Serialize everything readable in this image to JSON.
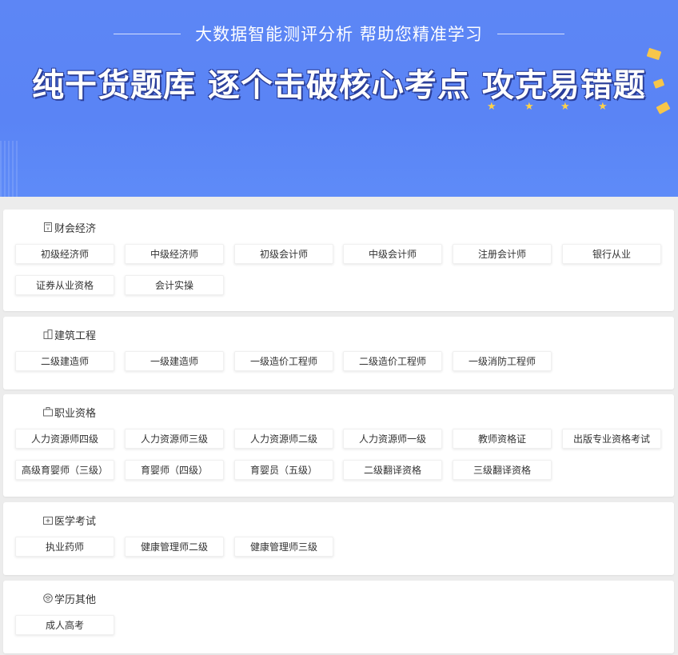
{
  "banner": {
    "subtitle": "大数据智能测评分析 帮助您精准学习",
    "headline": "纯干货题库 逐个击破核心考点 攻克易错题"
  },
  "categories": [
    {
      "name": "财会经济",
      "icon": "calculator-icon",
      "items": [
        "初级经济师",
        "中级经济师",
        "初级会计师",
        "中级会计师",
        "注册会计师",
        "银行从业",
        "证券从业资格",
        "会计实操"
      ]
    },
    {
      "name": "建筑工程",
      "icon": "building-icon",
      "items": [
        "二级建造师",
        "一级建造师",
        "一级造价工程师",
        "二级造价工程师",
        "一级消防工程师"
      ]
    },
    {
      "name": "职业资格",
      "icon": "briefcase-icon",
      "items": [
        "人力资源师四级",
        "人力资源师三级",
        "人力资源师二级",
        "人力资源师一级",
        "教师资格证",
        "出版专业资格考试",
        "高级育婴师（三级）",
        "育婴师（四级）",
        "育婴员（五级）",
        "二级翻译资格",
        "三级翻译资格"
      ]
    },
    {
      "name": "医学考试",
      "icon": "medical-kit-icon",
      "items": [
        "执业药师",
        "健康管理师二级",
        "健康管理师三级"
      ]
    },
    {
      "name": "学历其他",
      "icon": "graduation-icon",
      "items": [
        "成人高考"
      ]
    }
  ],
  "colors": {
    "banner": "#5a84f5",
    "accent_star": "#ffd24a",
    "text": "#333333"
  }
}
